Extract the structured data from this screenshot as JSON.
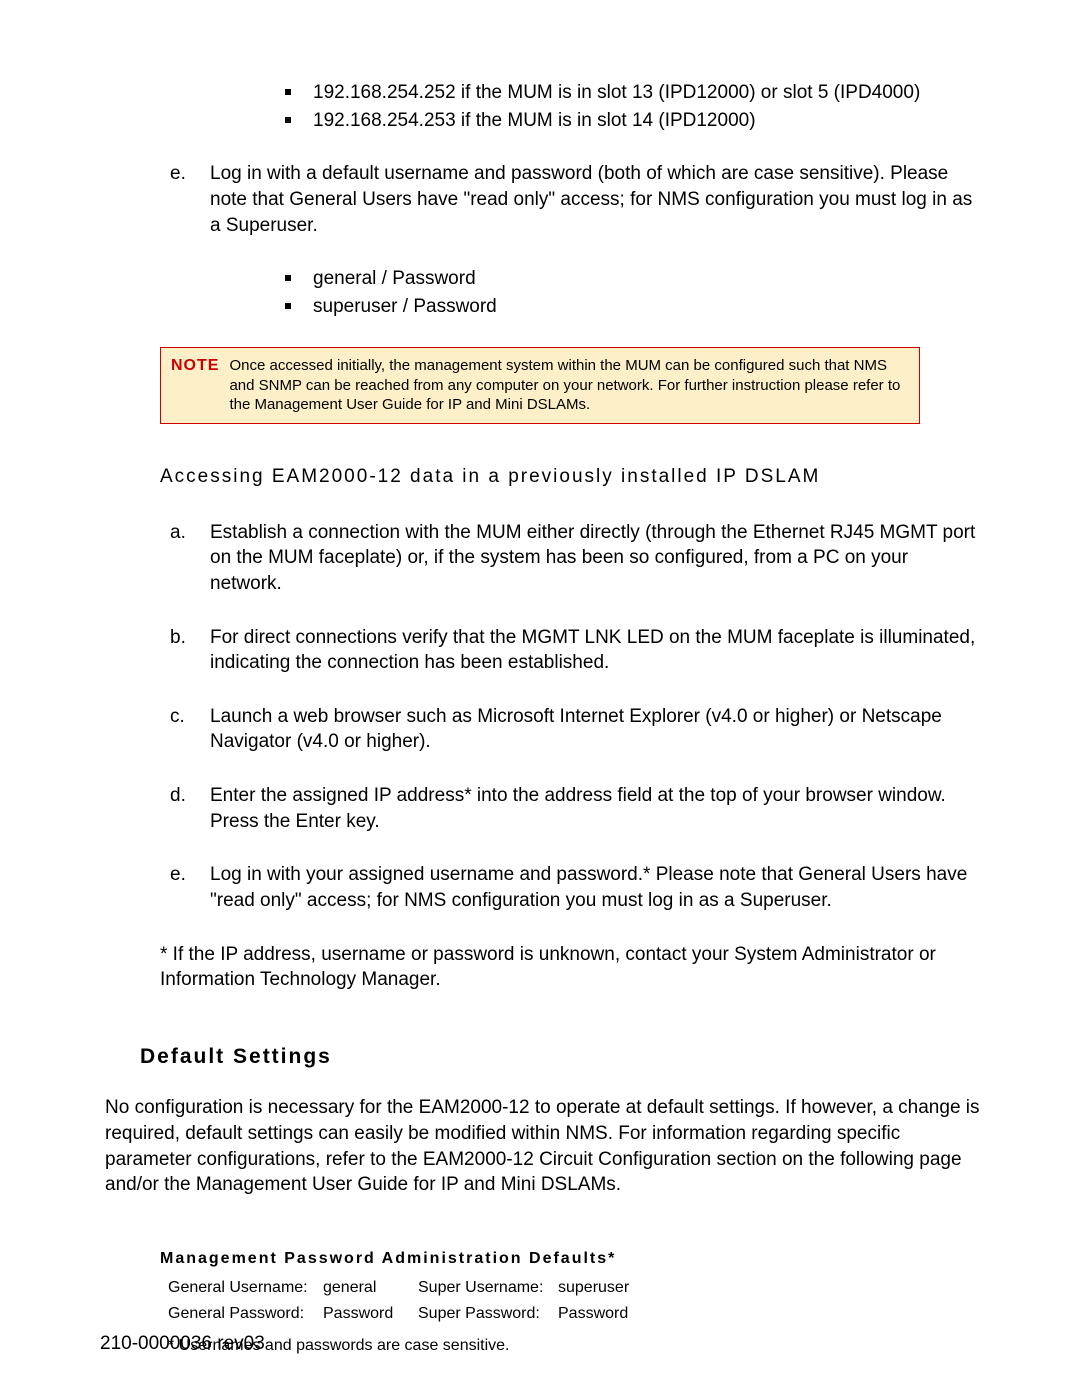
{
  "top_ips": {
    "items": [
      "192.168.254.252 if the MUM is in slot 13 (IPD12000) or slot 5 (IPD4000)",
      "192.168.254.253 if the MUM is in slot 14 (IPD12000)"
    ]
  },
  "step_e1": {
    "marker": "e.",
    "text": "Log in with a default username and password (both of which are case sensitive). Please note that General Users have \"read only\" access; for NMS configuration you must log in as a Superuser."
  },
  "creds": {
    "items": [
      "general / Password",
      "superuser / Password"
    ]
  },
  "note": {
    "label": "NOTE",
    "text": "Once accessed initially, the management system within the MUM can be configured such that NMS and SNMP can be reached from any computer on your network. For further instruction please refer to the Management User Guide for IP and Mini DSLAMs."
  },
  "subheading1": "Accessing EAM2000-12 data in a previously installed IP DSLAM",
  "steps2": {
    "a": {
      "marker": "a.",
      "text": "Establish a connection with the MUM either directly (through the Ethernet RJ45 MGMT port on the MUM faceplate) or, if the system has been so configured, from a PC on your network."
    },
    "b": {
      "marker": "b.",
      "text": "For direct connections verify that the MGMT LNK LED on the MUM faceplate is illuminated, indicating the connection has been established."
    },
    "c": {
      "marker": "c.",
      "text": "Launch a web browser such as Microsoft Internet Explorer (v4.0 or higher) or Netscape Navigator (v4.0 or higher)."
    },
    "d": {
      "marker": "d.",
      "text": "Enter the assigned IP address* into the address field at the top of your browser window. Press the Enter key."
    },
    "e": {
      "marker": "e.",
      "text": "Log in with your assigned username and password.* Please note that General Users have \"read only\" access; for NMS configuration you must log in as a Superuser."
    }
  },
  "asterisk_note": "* If the IP address, username or password is unknown, contact your System Administrator or Information Technology Manager.",
  "section_heading": "Default Settings",
  "body_para": "No configuration is necessary for the EAM2000-12 to operate at default settings. If however, a change is required, default settings can easily be modified within NMS. For information regarding specific parameter configurations, refer to the EAM2000-12 Circuit Configuration section on the following page and/or the Management User Guide for IP and Mini DSLAMs.",
  "defaults": {
    "title": "Management Password Administration Defaults*",
    "rows": [
      {
        "l1": "General Username:",
        "v1": "general",
        "l2": "Super Username:",
        "v2": "superuser"
      },
      {
        "l1": "General Password:",
        "v1": "Password",
        "l2": "Super Password:",
        "v2": "Password"
      }
    ],
    "note": "* Usernames and passwords are case sensitive."
  },
  "footer": "210-0000036 rev03"
}
